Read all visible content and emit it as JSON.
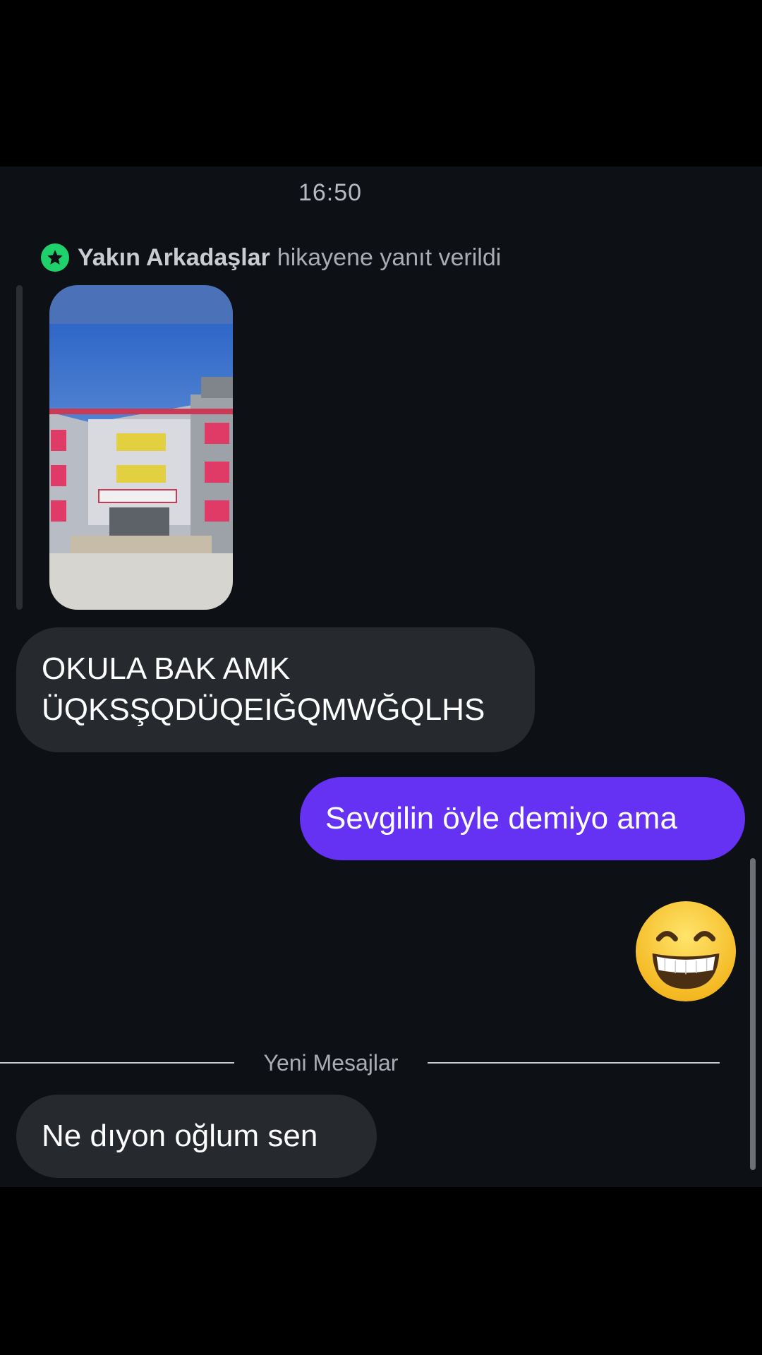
{
  "chat": {
    "timestamp": "16:50",
    "story_reply": {
      "audience": "Yakın Arkadaşlar",
      "text": "hikayene yanıt verildi",
      "badge_color": "#1fd16b",
      "thumbnail_icon": "school-building-photo"
    },
    "messages": [
      {
        "direction": "incoming",
        "line1": "OKULA BAK AMK",
        "line2": "ÜQKSŞQDÜQEIĞQMWĞQLHS"
      },
      {
        "direction": "outgoing",
        "text": "Sevgilin öyle demiyo ama",
        "color": "#6531f2"
      },
      {
        "direction": "outgoing",
        "emoji": "grinning-face-icon"
      }
    ],
    "new_messages_label": "Yeni Mesajlar",
    "last_message": "Ne dıyon oğlum sen"
  }
}
